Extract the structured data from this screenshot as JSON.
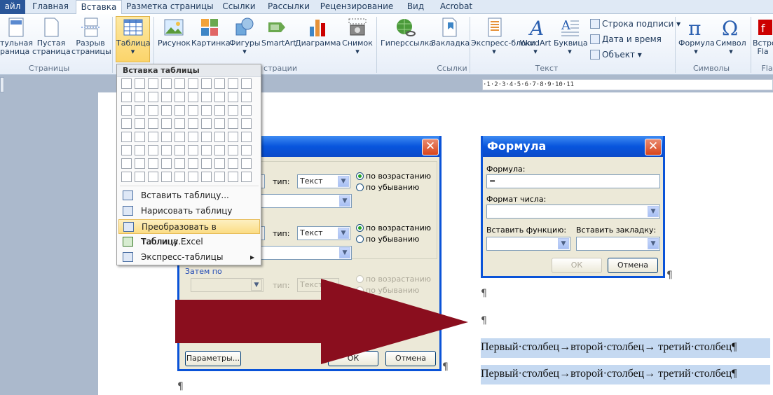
{
  "tabs": [
    "айл",
    "Главная",
    "Вставка",
    "Разметка страницы",
    "Ссылки",
    "Рассылки",
    "Рецензирование",
    "Вид",
    "Acrobat"
  ],
  "ribbon": {
    "pages_group": {
      "label": "Страницы",
      "cover": [
        "тульная",
        "раница"
      ],
      "blank": [
        "Пустая",
        "страница"
      ],
      "break": [
        "Разрыв",
        "страницы"
      ]
    },
    "table_group": {
      "table": "Таблица"
    },
    "illustrations": {
      "label": "страции",
      "picture": "Рисунок",
      "clipart": "Картинка",
      "shapes": "Фигуры",
      "smartart": "SmartArt",
      "chart": "Диаграмма",
      "screenshot": "Снимок"
    },
    "links": {
      "label": "Ссылки",
      "hyperlink": "Гиперссылка",
      "bookmark": "Закладка"
    },
    "text": {
      "label": "Текст",
      "express": "Экспресс-блоки",
      "wordart": "WordArt",
      "dropcap": "Буквица",
      "signature": "Строка подписи",
      "datetime": "Дата и время",
      "object": "Объект"
    },
    "symbols": {
      "label": "Символы",
      "formula": "Формула",
      "symbol": "Символ"
    },
    "flash": {
      "label": "Fla",
      "embed": [
        "Встро",
        "Fla"
      ]
    }
  },
  "table_menu": {
    "title": "Вставка таблицы",
    "items": [
      "Вставить таблицу...",
      "Нарисовать таблицу",
      "Преобразовать в таблицу...",
      "Таблица Excel",
      "Экспресс-таблицы"
    ]
  },
  "sort_dialog": {
    "type_label": "тип:",
    "type_value": "Текст",
    "ascending": "по возрастанию",
    "descending": "по убыванию",
    "then_by": "Затем по",
    "params": "Параметры...",
    "ok": "ОК",
    "cancel": "Отмена"
  },
  "formula_dialog": {
    "title": "Формула",
    "formula_label": "Формула:",
    "formula_value": "=",
    "format_label": "Формат числа:",
    "func_label": "Вставить функцию:",
    "bookmark_label": "Вставить закладку:",
    "ok": "ОК",
    "cancel": "Отмена"
  },
  "document": {
    "pilcrow": "¶",
    "line1": "Первый·столбец→второй·столбец→ третий·столбец¶",
    "line2": "Первый·столбец→второй·столбец→ третий·столбец¶",
    "ruler": "·1·2·3·4·5·6·7·8·9·10·11"
  },
  "colors": {
    "arrow": "#8a0e1e",
    "ribbon_tab_file": "#2a5699",
    "highlight": "#c5d9f1",
    "xp_title": "#0855dd"
  }
}
